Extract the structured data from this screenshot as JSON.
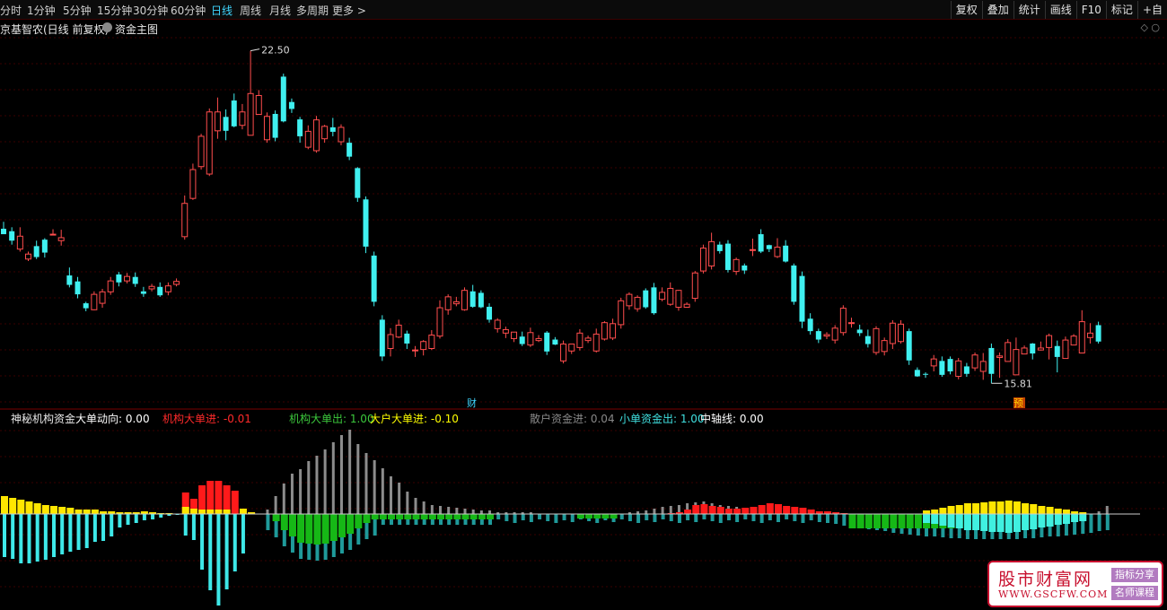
{
  "toolbar": {
    "timeframes": [
      {
        "label": "分时",
        "active": false
      },
      {
        "label": "1分钟",
        "active": false
      },
      {
        "label": "5分钟",
        "active": false
      },
      {
        "label": "15分钟",
        "active": false
      },
      {
        "label": "30分钟",
        "active": false
      },
      {
        "label": "60分钟",
        "active": false
      },
      {
        "label": "日线",
        "active": true
      },
      {
        "label": "周线",
        "active": false
      },
      {
        "label": "月线",
        "active": false
      },
      {
        "label": "多周期",
        "active": false
      },
      {
        "label": "更多 >",
        "active": false
      }
    ],
    "right_buttons": [
      "复权",
      "叠加",
      "统计",
      "画线",
      "F10",
      "标记",
      "+自"
    ]
  },
  "title": {
    "stock_name": "京基智农(日线 前复权)",
    "main_indicator": "资金主图",
    "right_icons": "◇ ○"
  },
  "price_chart": {
    "high_label": "22.50",
    "low_label": "15.81",
    "marker_cai": "财",
    "marker_yu": "预",
    "colors": {
      "up": "#ff4d4d",
      "down": "#40f0f0",
      "grid": "#3a0000"
    }
  },
  "indicator": {
    "name": "神秘机构资金",
    "legend": [
      {
        "label": "大单动向:",
        "value": "0.00",
        "color": "#ffffff"
      },
      {
        "label": "机构大单进:",
        "value": "-0.01",
        "color": "#ff2a2a"
      },
      {
        "label": "机构大单出:",
        "value": "1.00",
        "color": "#3cc83c"
      },
      {
        "label": "大户大单进:",
        "value": "-0.10",
        "color": "#ffff00"
      },
      {
        "label": "散户资金进:",
        "value": "0.04",
        "color": "#888888"
      },
      {
        "label": "小单资金出:",
        "value": "1.00",
        "color": "#40e0e0"
      },
      {
        "label": "中轴线:",
        "value": "0.00",
        "color": "#ffffff"
      }
    ]
  },
  "chart_data": {
    "type": "candlestick",
    "open": [
      18.92,
      18.87,
      18.51,
      18.31,
      18.57,
      18.7,
      18.81,
      18.68,
      17.98,
      17.86,
      17.42,
      17.29,
      17.42,
      17.65,
      18.0,
      17.87,
      17.95,
      17.66,
      17.71,
      17.75,
      17.65,
      17.8,
      18.76,
      19.53,
      20.17,
      20.02,
      20.89,
      21.17,
      21.5,
      21.0,
      20.8,
      21.22,
      20.71,
      21.23,
      21.98,
      21.47,
      21.12,
      20.56,
      20.49,
      20.73,
      20.96,
      20.67,
      20.65,
      20.14,
      19.51,
      18.38,
      17.09,
      16.51,
      16.74,
      16.81,
      16.48,
      16.49,
      16.51,
      16.76,
      17.29,
      17.41,
      17.29,
      17.66,
      17.63,
      17.35,
      16.91,
      16.82,
      16.71,
      16.75,
      16.58,
      16.67,
      16.83,
      16.69,
      16.26,
      16.46,
      16.53,
      16.67,
      16.46,
      16.7,
      16.72,
      16.99,
      17.37,
      17.31,
      17.68,
      17.74,
      17.5,
      17.4,
      17.34,
      17.34,
      17.52,
      18.07,
      18.17,
      18.6,
      18.62,
      18.06,
      18.18,
      18.5,
      18.81,
      18.59,
      18.36,
      18.58,
      18.18,
      17.97,
      17.11,
      16.86,
      16.76,
      16.68,
      16.83,
      17.02,
      16.89,
      16.76,
      16.43,
      16.45,
      16.61,
      16.65,
      16.86,
      16.08,
      16.0,
      16.16,
      16.26,
      16.3,
      15.95,
      16.15,
      16.12,
      16.05,
      16.52,
      16.33,
      16.25,
      15.98,
      16.4,
      16.61,
      16.48,
      16.53,
      16.56,
      16.31,
      16.58,
      16.42,
      16.73,
      16.98,
      16.96
    ],
    "close": [
      18.81,
      18.68,
      18.77,
      18.41,
      18.35,
      18.44,
      18.81,
      18.74,
      17.79,
      17.6,
      17.32,
      17.6,
      17.65,
      17.87,
      17.84,
      17.96,
      17.81,
      17.61,
      17.76,
      17.58,
      17.77,
      17.86,
      19.43,
      20.11,
      20.78,
      21.27,
      21.27,
      20.89,
      20.98,
      21.27,
      21.64,
      21.6,
      21.18,
      20.75,
      21.08,
      21.33,
      20.78,
      20.88,
      21.11,
      20.98,
      20.87,
      20.96,
      20.37,
      19.54,
      18.56,
      17.45,
      16.35,
      16.79,
      16.98,
      16.61,
      16.48,
      16.65,
      16.78,
      17.33,
      17.55,
      17.45,
      17.68,
      17.35,
      17.34,
      17.09,
      17.08,
      16.89,
      16.84,
      16.6,
      16.83,
      16.71,
      16.45,
      16.59,
      16.6,
      16.6,
      16.82,
      16.72,
      16.8,
      17.03,
      17.01,
      17.47,
      17.6,
      17.54,
      17.34,
      17.22,
      17.64,
      17.72,
      17.68,
      17.4,
      18.03,
      18.53,
      18.66,
      18.47,
      18.09,
      18.3,
      18.08,
      18.5,
      18.46,
      18.51,
      18.55,
      18.26,
      17.45,
      17.05,
      16.86,
      16.69,
      16.79,
      16.92,
      17.32,
      17.03,
      16.82,
      16.6,
      16.91,
      16.67,
      17.02,
      17.0,
      16.27,
      15.95,
      15.99,
      16.3,
      15.98,
      16.05,
      16.26,
      16.0,
      16.38,
      16.25,
      16.0,
      16.36,
      16.63,
      16.49,
      16.52,
      16.41,
      16.52,
      16.77,
      16.34,
      16.68,
      16.76,
      17.05,
      16.82,
      16.65
    ],
    "high": [
      19.06,
      18.95,
      18.95,
      18.46,
      18.68,
      18.73,
      18.91,
      18.9,
      18.14,
      17.95,
      17.45,
      17.66,
      17.71,
      17.95,
      18.05,
      18.03,
      18.04,
      17.75,
      17.81,
      17.84,
      17.84,
      17.92,
      19.59,
      20.23,
      20.83,
      21.34,
      21.56,
      21.32,
      21.64,
      21.43,
      22.5,
      21.71,
      21.26,
      21.3,
      22.04,
      21.54,
      21.17,
      21.0,
      21.19,
      21.01,
      21.15,
      21.02,
      20.75,
      20.16,
      19.57,
      18.46,
      17.18,
      16.92,
      17.09,
      16.87,
      16.56,
      16.68,
      16.88,
      17.48,
      17.6,
      17.55,
      17.74,
      17.79,
      17.68,
      17.42,
      17.12,
      16.95,
      16.81,
      16.85,
      16.93,
      16.78,
      16.86,
      16.74,
      16.67,
      16.6,
      16.9,
      16.77,
      16.91,
      17.06,
      17.11,
      17.53,
      17.64,
      17.58,
      17.72,
      17.83,
      17.74,
      17.84,
      17.69,
      17.44,
      18.07,
      18.6,
      18.84,
      18.66,
      18.69,
      18.34,
      18.22,
      18.72,
      18.91,
      18.6,
      18.73,
      18.69,
      18.22,
      18.06,
      17.22,
      16.91,
      16.84,
      16.98,
      17.38,
      17.13,
      16.99,
      16.89,
      16.96,
      16.73,
      17.08,
      17.08,
      16.91,
      16.13,
      16.03,
      16.38,
      16.35,
      16.35,
      16.32,
      16.22,
      16.43,
      16.42,
      16.61,
      16.43,
      16.7,
      16.73,
      16.57,
      16.62,
      16.65,
      16.81,
      16.67,
      16.75,
      16.8,
      17.28,
      17.02,
      17.05
    ],
    "low": [
      18.84,
      18.6,
      18.46,
      18.27,
      18.31,
      18.34,
      18.79,
      18.58,
      17.74,
      17.52,
      17.26,
      17.28,
      17.33,
      17.59,
      17.76,
      17.82,
      17.75,
      17.55,
      17.66,
      17.55,
      17.58,
      17.76,
      18.7,
      19.5,
      20.11,
      19.98,
      20.73,
      20.7,
      20.96,
      20.92,
      20.8,
      21.22,
      20.65,
      20.68,
      21.06,
      21.25,
      20.65,
      20.52,
      20.45,
      20.65,
      20.78,
      20.6,
      20.3,
      19.46,
      18.43,
      17.36,
      16.26,
      16.35,
      16.72,
      16.5,
      16.34,
      16.37,
      16.48,
      16.71,
      17.19,
      17.36,
      17.27,
      17.33,
      17.32,
      17.03,
      16.83,
      16.72,
      16.64,
      16.56,
      16.54,
      16.64,
      16.38,
      16.58,
      16.21,
      16.4,
      16.47,
      16.62,
      16.43,
      16.67,
      16.68,
      16.91,
      17.29,
      17.25,
      17.31,
      17.19,
      17.46,
      17.37,
      17.27,
      17.33,
      17.45,
      18.02,
      18.1,
      18.42,
      18.04,
      17.99,
      18.01,
      18.37,
      18.43,
      18.45,
      18.33,
      18.24,
      17.39,
      16.92,
      16.79,
      16.62,
      16.7,
      16.61,
      16.77,
      16.93,
      16.76,
      16.53,
      16.38,
      16.37,
      16.5,
      16.61,
      16.18,
      15.94,
      15.92,
      16.05,
      15.94,
      15.99,
      15.89,
      15.94,
      16.06,
      15.88,
      15.81,
      15.92,
      16.37,
      16.45,
      16.43,
      16.29,
      16.47,
      16.29,
      16.03,
      16.33,
      16.66,
      16.91,
      16.61,
      16.61
    ],
    "flow_up": [
      3,
      3,
      2,
      2,
      1,
      1,
      1,
      1,
      0,
      0,
      0,
      0,
      0,
      0,
      0,
      0,
      0,
      0,
      0,
      0,
      0,
      0,
      24,
      17,
      32,
      37,
      37,
      32,
      26,
      0,
      2,
      0,
      0,
      0,
      0,
      0,
      0,
      0,
      0,
      0,
      0,
      0,
      0,
      0,
      0,
      0,
      0,
      0,
      0,
      0,
      0,
      0,
      0,
      0,
      0,
      0,
      0,
      0,
      0,
      0,
      0,
      0,
      0,
      0,
      0,
      0,
      0,
      0,
      0,
      0,
      0,
      0,
      0,
      0,
      0,
      0,
      0,
      0,
      0,
      0,
      0,
      1,
      2,
      5,
      10,
      11,
      9,
      8,
      6,
      6,
      7,
      8,
      10,
      12,
      11,
      9,
      8,
      7,
      5,
      3,
      3,
      2,
      1,
      0,
      0,
      0,
      0,
      0,
      0,
      0,
      0,
      0,
      0,
      0,
      0,
      0,
      0,
      0,
      0,
      0,
      0,
      0,
      0,
      0,
      0,
      0,
      0,
      0,
      0,
      0,
      0,
      0,
      0,
      0,
      0,
      0,
      0,
      0,
      0
    ],
    "flow_up2": [
      20,
      18,
      16,
      14,
      12,
      10,
      9,
      8,
      7,
      5,
      5,
      5,
      3,
      3,
      2,
      2,
      2,
      3,
      2,
      1,
      1,
      0,
      8,
      6,
      5,
      5,
      5,
      5,
      0,
      6,
      2,
      0,
      0,
      0,
      0,
      0,
      0,
      0,
      0,
      0,
      0,
      0,
      0,
      0,
      0,
      0,
      0,
      0,
      0,
      0,
      0,
      0,
      0,
      0,
      0,
      0,
      0,
      0,
      0,
      0,
      0,
      0,
      0,
      0,
      0,
      0,
      0,
      0,
      0,
      0,
      0,
      0,
      0,
      0,
      0,
      0,
      0,
      0,
      0,
      0,
      0,
      0,
      0,
      0,
      0,
      0,
      0,
      0,
      0,
      0,
      0,
      0,
      0,
      0,
      0,
      0,
      0,
      0,
      0,
      0,
      0,
      0,
      0,
      0,
      0,
      0,
      0,
      0,
      0,
      0,
      0,
      0,
      4,
      5,
      7,
      9,
      10,
      12,
      12,
      13,
      14,
      14,
      15,
      14,
      12,
      11,
      9,
      8,
      6,
      5,
      3,
      2,
      0,
      0,
      0,
      0,
      0
    ],
    "flow_gray": [
      0,
      0,
      0,
      0,
      0,
      0,
      0,
      0,
      0,
      0,
      0,
      0,
      0,
      0,
      0,
      0,
      0,
      0,
      0,
      0,
      0,
      0,
      0,
      0,
      0,
      0,
      0,
      0,
      0,
      0,
      0,
      0,
      5,
      20,
      34,
      45,
      50,
      59,
      65,
      72,
      80,
      88,
      94,
      78,
      68,
      60,
      51,
      42,
      35,
      25,
      18,
      14,
      10,
      9,
      8,
      7,
      6,
      5,
      4,
      4,
      2,
      2,
      2,
      2,
      2,
      0,
      0,
      0,
      0,
      0,
      0,
      0,
      0,
      0,
      0,
      0,
      2,
      3,
      4,
      6,
      8,
      9,
      10,
      12,
      13,
      14,
      12,
      10,
      9,
      8,
      7,
      7,
      6,
      5,
      4,
      3,
      2,
      1,
      0,
      1,
      0,
      0,
      0,
      0,
      0,
      0,
      0,
      0,
      0,
      0,
      0,
      0,
      0,
      0,
      0,
      0,
      0,
      0,
      0,
      0,
      0,
      0,
      0,
      0,
      0,
      0,
      0,
      0,
      0,
      0,
      0,
      0,
      0,
      3,
      9,
      10,
      10,
      10,
      10
    ],
    "flow_down": [
      48,
      50,
      55,
      55,
      53,
      51,
      48,
      45,
      42,
      40,
      38,
      31,
      30,
      25,
      15,
      12,
      10,
      7,
      6,
      4,
      2,
      1,
      24,
      29,
      62,
      85,
      102,
      84,
      64,
      44,
      3,
      0,
      0,
      0,
      0,
      0,
      0,
      0,
      0,
      0,
      0,
      0,
      0,
      0,
      0,
      0,
      0,
      0,
      0,
      0,
      0,
      0,
      0,
      0,
      0,
      0,
      0,
      0,
      0,
      0,
      0,
      0,
      0,
      0,
      0,
      0,
      0,
      0,
      0,
      0,
      0,
      0,
      0,
      0,
      0,
      0,
      0,
      0,
      0,
      0,
      0,
      0,
      0,
      0,
      0,
      0,
      0,
      0,
      0,
      0,
      0,
      0,
      0,
      0,
      0,
      0,
      0,
      0,
      0,
      0,
      0,
      0,
      0,
      0,
      0,
      0,
      0,
      0,
      0,
      0,
      0,
      0,
      0,
      0,
      0,
      0,
      0,
      0,
      0,
      0,
      0,
      0,
      0,
      0,
      0,
      0,
      0,
      0,
      0,
      0,
      0,
      0,
      0,
      0,
      0,
      0,
      0,
      0,
      0
    ],
    "flow_green": [
      0,
      0,
      0,
      0,
      0,
      0,
      0,
      0,
      0,
      0,
      0,
      0,
      0,
      0,
      0,
      0,
      0,
      0,
      0,
      0,
      0,
      0,
      0,
      0,
      0,
      0,
      0,
      0,
      0,
      0,
      0,
      0,
      0,
      0,
      0,
      0,
      0,
      0,
      0,
      0,
      0,
      0,
      0,
      0,
      0,
      0,
      0,
      0,
      0,
      0,
      0,
      0,
      0,
      0,
      0,
      0,
      0,
      0,
      0,
      0,
      0,
      0,
      0,
      0,
      0,
      0,
      0,
      0,
      0,
      0,
      0,
      0,
      0,
      0,
      0,
      0,
      0,
      0,
      0,
      0,
      0,
      0,
      0,
      0,
      0,
      0,
      0,
      0,
      0,
      0,
      0,
      0,
      0,
      0,
      0,
      0,
      0,
      0,
      0,
      0,
      0,
      0,
      0,
      0,
      0,
      0,
      0,
      0,
      0,
      0,
      0,
      0,
      0,
      0,
      0,
      0,
      0,
      0,
      0,
      0,
      0,
      0,
      0,
      0,
      0,
      0,
      0,
      0,
      0,
      0,
      0,
      0,
      0,
      0,
      0,
      0,
      0,
      0,
      0
    ]
  }
}
